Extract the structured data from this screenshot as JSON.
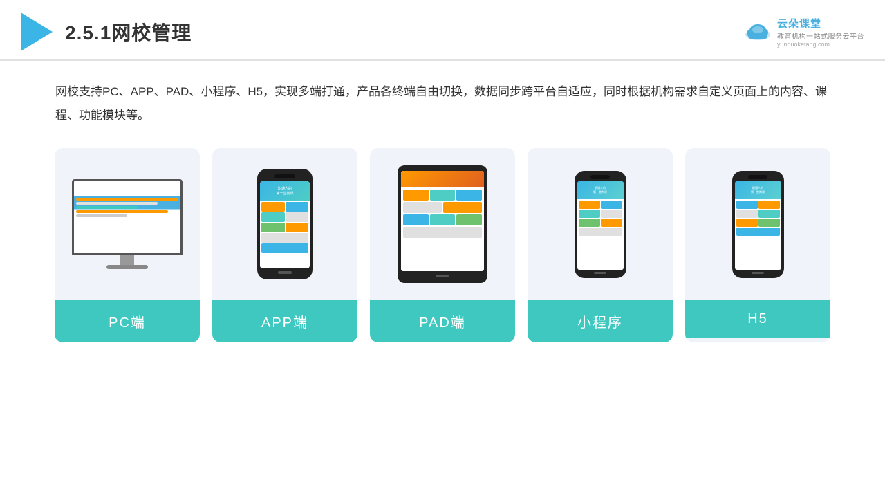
{
  "header": {
    "title": "2.5.1网校管理",
    "brand": {
      "name": "云朵课堂",
      "url": "yunduoketang.com",
      "tagline": "教育机构一站式服务云平台"
    }
  },
  "description": "网校支持PC、APP、PAD、小程序、H5，实现多端打通，产品各终端自由切换，数据同步跨平台自适应，同时根据机构需求自定义页面上的内容、课程、功能模块等。",
  "cards": [
    {
      "id": "pc",
      "label": "PC端"
    },
    {
      "id": "app",
      "label": "APP端"
    },
    {
      "id": "pad",
      "label": "PAD端"
    },
    {
      "id": "miniapp",
      "label": "小程序"
    },
    {
      "id": "h5",
      "label": "H5"
    }
  ],
  "colors": {
    "accent": "#3ec8c0",
    "header_line": "#e0e0e0",
    "bg": "#f0f4fa"
  }
}
